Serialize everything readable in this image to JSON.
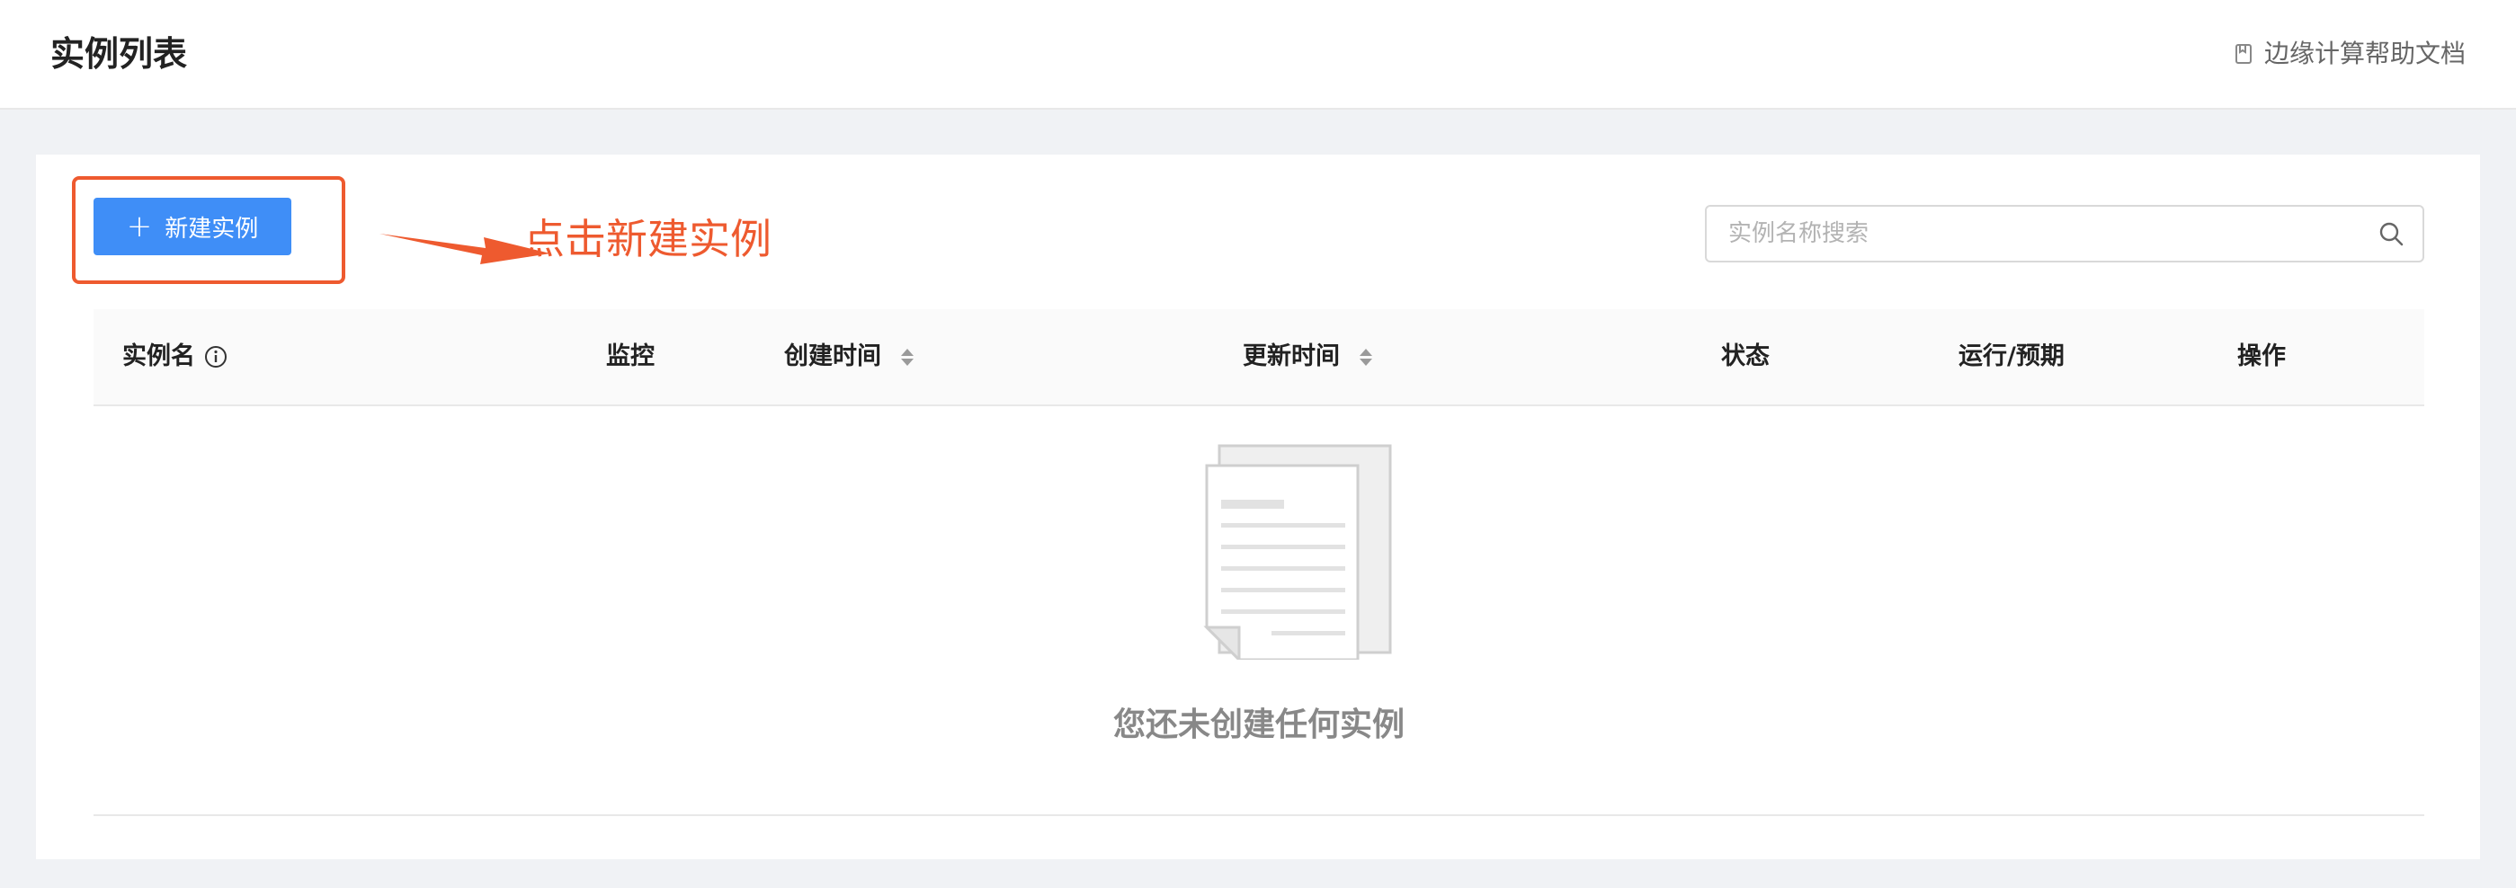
{
  "header": {
    "title": "实例列表",
    "help_link": "边缘计算帮助文档"
  },
  "toolbar": {
    "new_button_label": "新建实例",
    "callout_text": "点击新建实例",
    "search_placeholder": "实例名称搜索",
    "search_value": ""
  },
  "table": {
    "columns": [
      "实例名",
      "监控",
      "创建时间",
      "更新时间",
      "状态",
      "运行/预期",
      "操作"
    ],
    "rows": []
  },
  "empty_state": {
    "message": "您还未创建任何实例"
  },
  "colors": {
    "primary": "#3f8ef7",
    "annotation": "#ee5a2f"
  }
}
